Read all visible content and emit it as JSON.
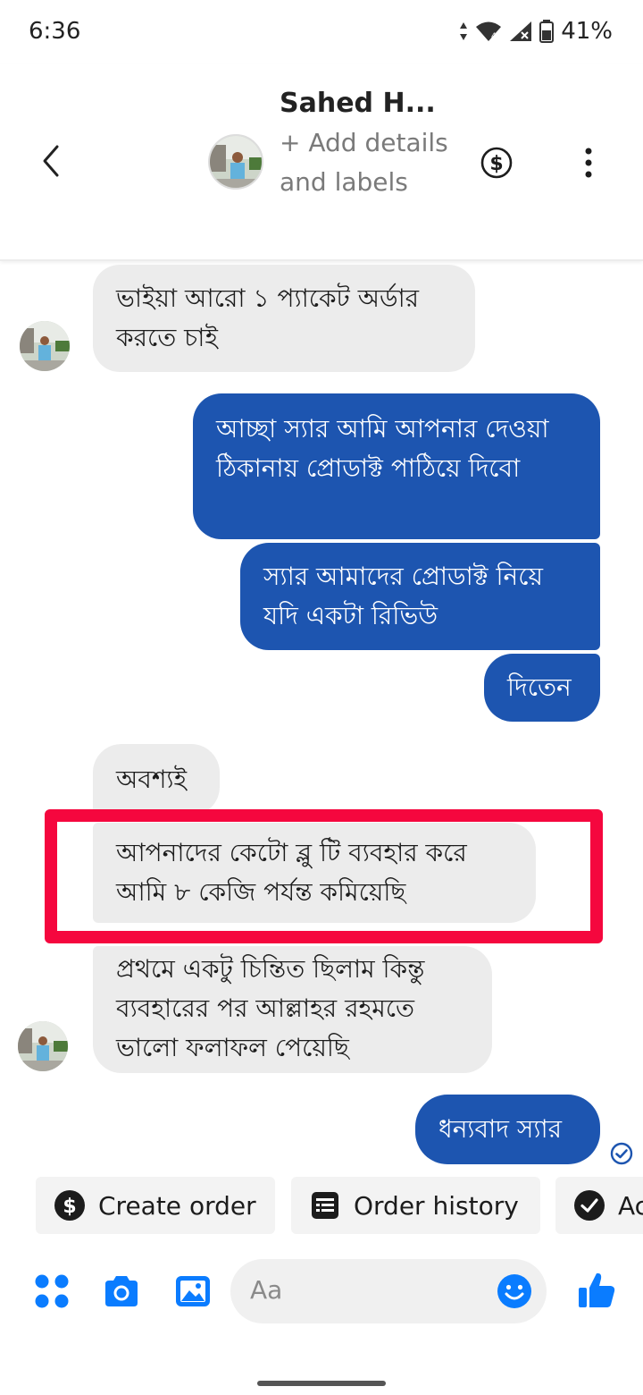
{
  "status_bar": {
    "time": "6:36",
    "battery": "41%"
  },
  "header": {
    "contact_name": "Sahed H...",
    "add_details": "+ Add details and labels"
  },
  "messages": [
    {
      "direction": "in",
      "text": "ভাইয়া আরো ১ প্যাকেট অর্ডার করতে চাই"
    },
    {
      "direction": "out",
      "text": "আচ্ছা স্যার আমি আপনার দেওয়া ঠিকানায় প্রোডাক্ট পাঠিয়ে দিবো"
    },
    {
      "direction": "out",
      "text": "স্যার আমাদের প্রোডাক্ট নিয়ে যদি একটা রিভিউ"
    },
    {
      "direction": "out",
      "text": "দিতেন"
    },
    {
      "direction": "in",
      "text": "অবশ্যই"
    },
    {
      "direction": "in",
      "text": "আপনাদের কেটো ব্লু টি ব্যবহার করে আমি ৮ কেজি পর্যন্ত কমিয়েছি",
      "highlighted": true
    },
    {
      "direction": "in",
      "text": "প্রথমে একটু চিন্তিত ছিলাম কিন্তু ব্যবহারের পর আল্লাহর রহমতে ভালো ফলাফল পেয়েছি"
    },
    {
      "direction": "out",
      "text": "ধন্যবাদ স্যার"
    }
  ],
  "quick_replies": [
    {
      "label": "Create order",
      "icon": "dollar-circle-icon"
    },
    {
      "label": "Order history",
      "icon": "receipt-list-icon"
    },
    {
      "label": "Ac",
      "icon": "check-circle-icon"
    }
  ],
  "composer": {
    "placeholder": "Aa"
  },
  "colors": {
    "accent": "#1d55b0",
    "incoming_bubble": "#ececec",
    "highlight": "#f5073e",
    "icon_blue": "#0a7cff"
  }
}
